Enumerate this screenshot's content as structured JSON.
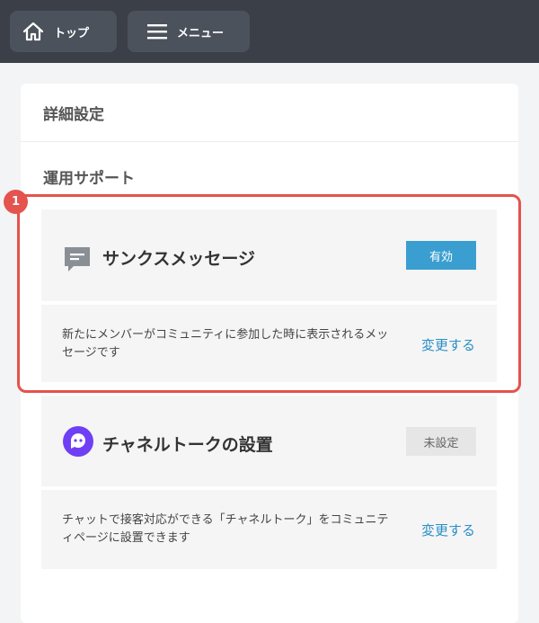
{
  "header": {
    "home_label": "トップ",
    "menu_label": "メニュー",
    "background_color": "#3a3f48"
  },
  "card": {
    "title": "詳細設定",
    "section_title": "運用サポート"
  },
  "items": [
    {
      "icon": "message-bubble-icon",
      "title": "サンクスメッセージ",
      "status": "有効",
      "status_color": "#3a9fd0",
      "description": "新たにメンバーがコミュニティに参加した時に表示されるメッセージです",
      "action_label": "変更する"
    },
    {
      "icon": "channel-talk-icon",
      "title": "チャネルトークの設置",
      "status": "未設定",
      "status_color": "#e6e6e6",
      "description": "チャットで接客対応ができる「チャネルトーク」をコミュニティページに設置できます",
      "action_label": "変更する"
    }
  ],
  "annotation": {
    "marker_number": "1",
    "color": "#e4534d"
  }
}
